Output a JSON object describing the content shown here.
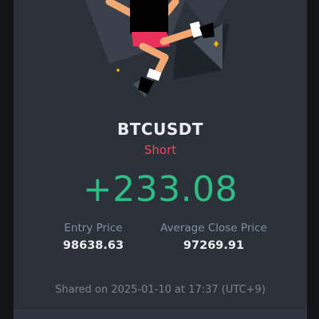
{
  "trade": {
    "symbol": "BTCUSDT",
    "side": "Short",
    "pnl": "+233.08"
  },
  "prices": {
    "entry_label": "Entry Price",
    "entry_value": "98638.63",
    "close_label": "Average Close Price",
    "close_value": "97269.91"
  },
  "footer": {
    "shared_text": "Shared on 2025-01-10 at 17:37 (UTC+9)"
  },
  "colors": {
    "background": "#2b3139",
    "profit": "#2ebd85",
    "short": "#f6465d",
    "muted": "#848e9c",
    "text": "#eaecef",
    "accent": "#f0b90b"
  },
  "icons": {
    "hero": "jumping-character-illustration"
  }
}
